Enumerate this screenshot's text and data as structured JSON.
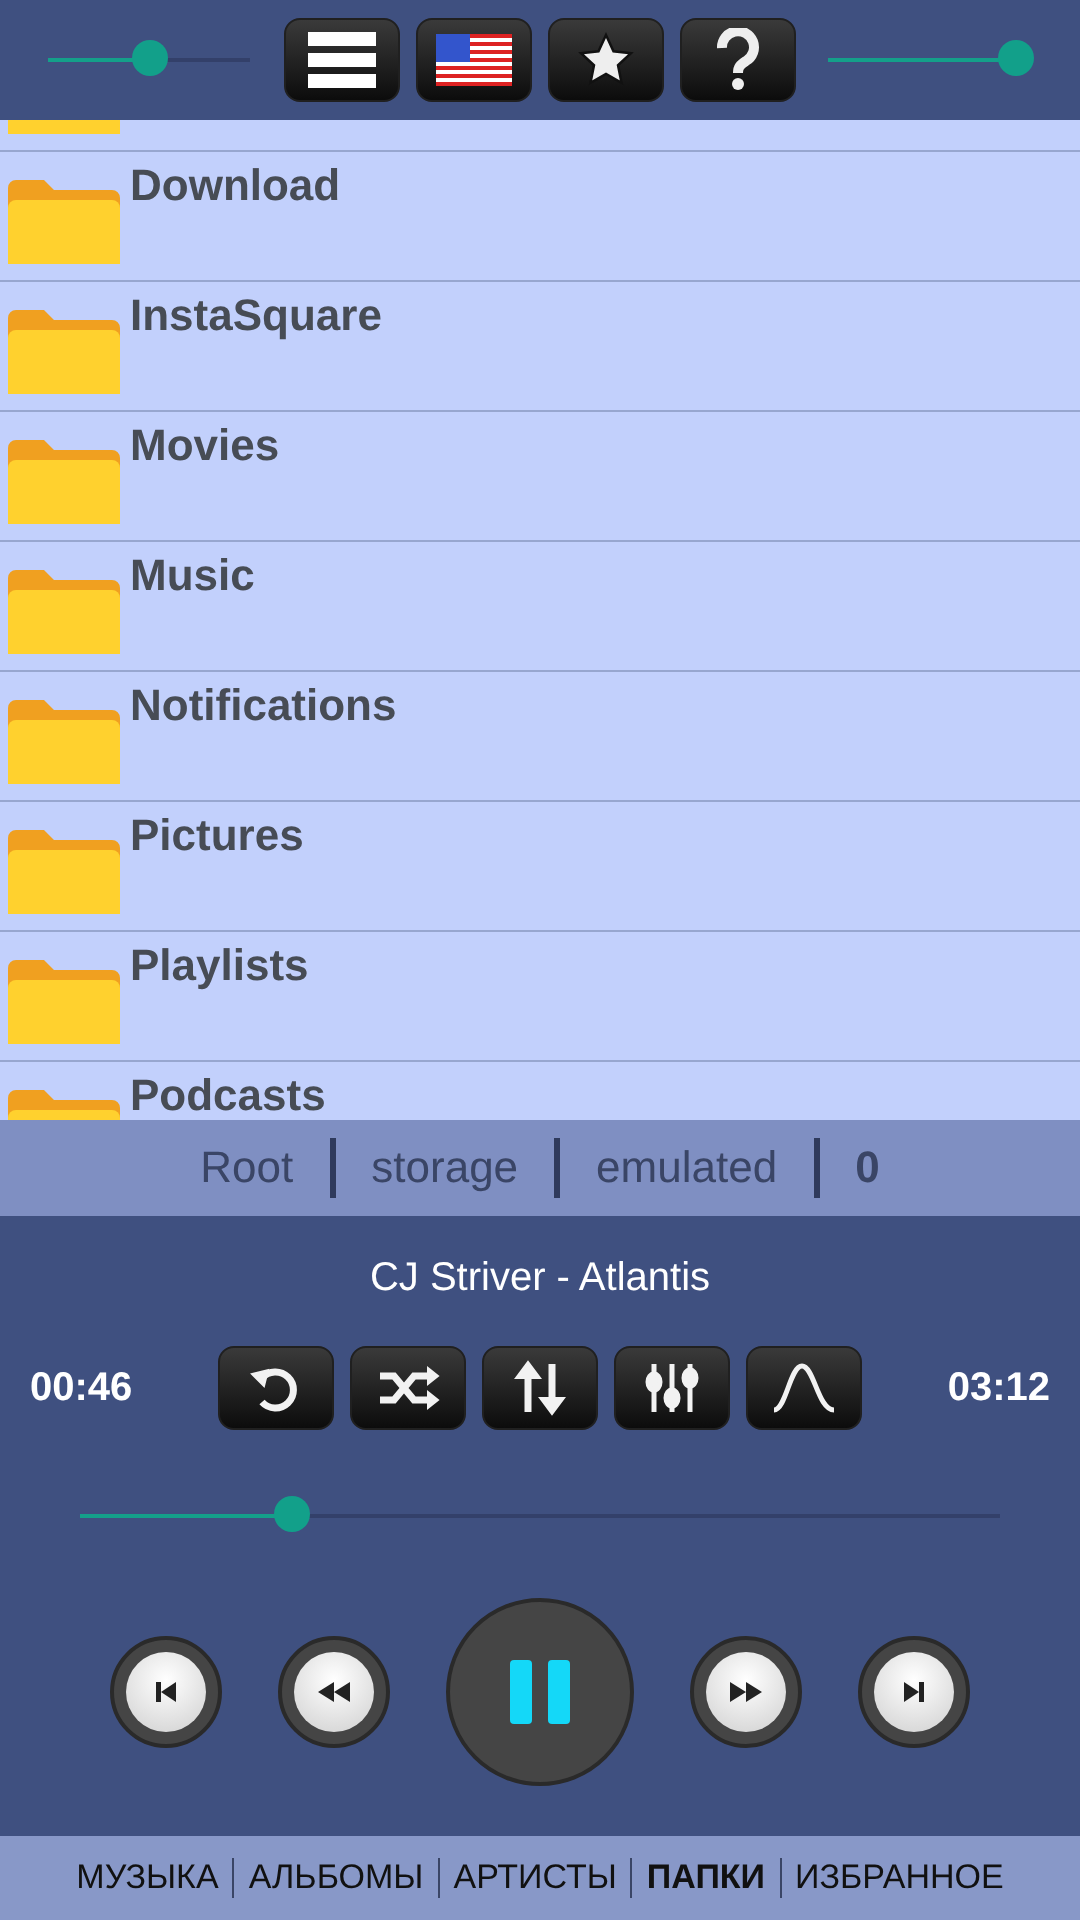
{
  "top_bar": {
    "left_slider": {
      "level": 0.5
    },
    "buttons": [
      {
        "kind": "menu"
      },
      {
        "kind": "flag"
      },
      {
        "kind": "star"
      },
      {
        "kind": "help"
      }
    ],
    "right_slider": {
      "level": 0.92
    }
  },
  "folders": [
    {
      "kind": "folder"
    },
    {
      "kind": "folder",
      "name": "Download"
    },
    {
      "kind": "folder",
      "name": "InstaSquare"
    },
    {
      "kind": "folder",
      "name": "Movies"
    },
    {
      "kind": "folder",
      "name": "Music"
    },
    {
      "kind": "folder",
      "name": "Notifications"
    },
    {
      "kind": "folder",
      "name": "Pictures"
    },
    {
      "kind": "folder",
      "name": "Playlists"
    },
    {
      "kind": "folder",
      "name": "Podcasts"
    }
  ],
  "breadcrumb": [
    {
      "label": "Root",
      "current": false
    },
    {
      "label": "storage",
      "current": false
    },
    {
      "label": "emulated",
      "current": false
    },
    {
      "label": "0",
      "current": true
    }
  ],
  "player": {
    "track": "CJ Striver - Atlantis",
    "elapsed": "00:46",
    "duration": "03:12",
    "tools": [
      {
        "kind": "repeat"
      },
      {
        "kind": "shuffle"
      },
      {
        "kind": "order"
      },
      {
        "kind": "equalizer"
      },
      {
        "kind": "wave"
      }
    ],
    "progress": {
      "level": 0.23
    },
    "transport": [
      {
        "kind": "previous"
      },
      {
        "kind": "rewind"
      },
      {
        "kind": "pause"
      },
      {
        "kind": "forward"
      },
      {
        "kind": "next"
      }
    ]
  },
  "nav": [
    {
      "label": "МУЗЫКА",
      "selected": false
    },
    {
      "label": "АЛЬБОМЫ",
      "selected": false
    },
    {
      "label": "АРТИСТЫ",
      "selected": false
    },
    {
      "label": "ПАПКИ",
      "selected": true
    },
    {
      "label": "ИЗБРАННОЕ",
      "selected": false
    }
  ]
}
